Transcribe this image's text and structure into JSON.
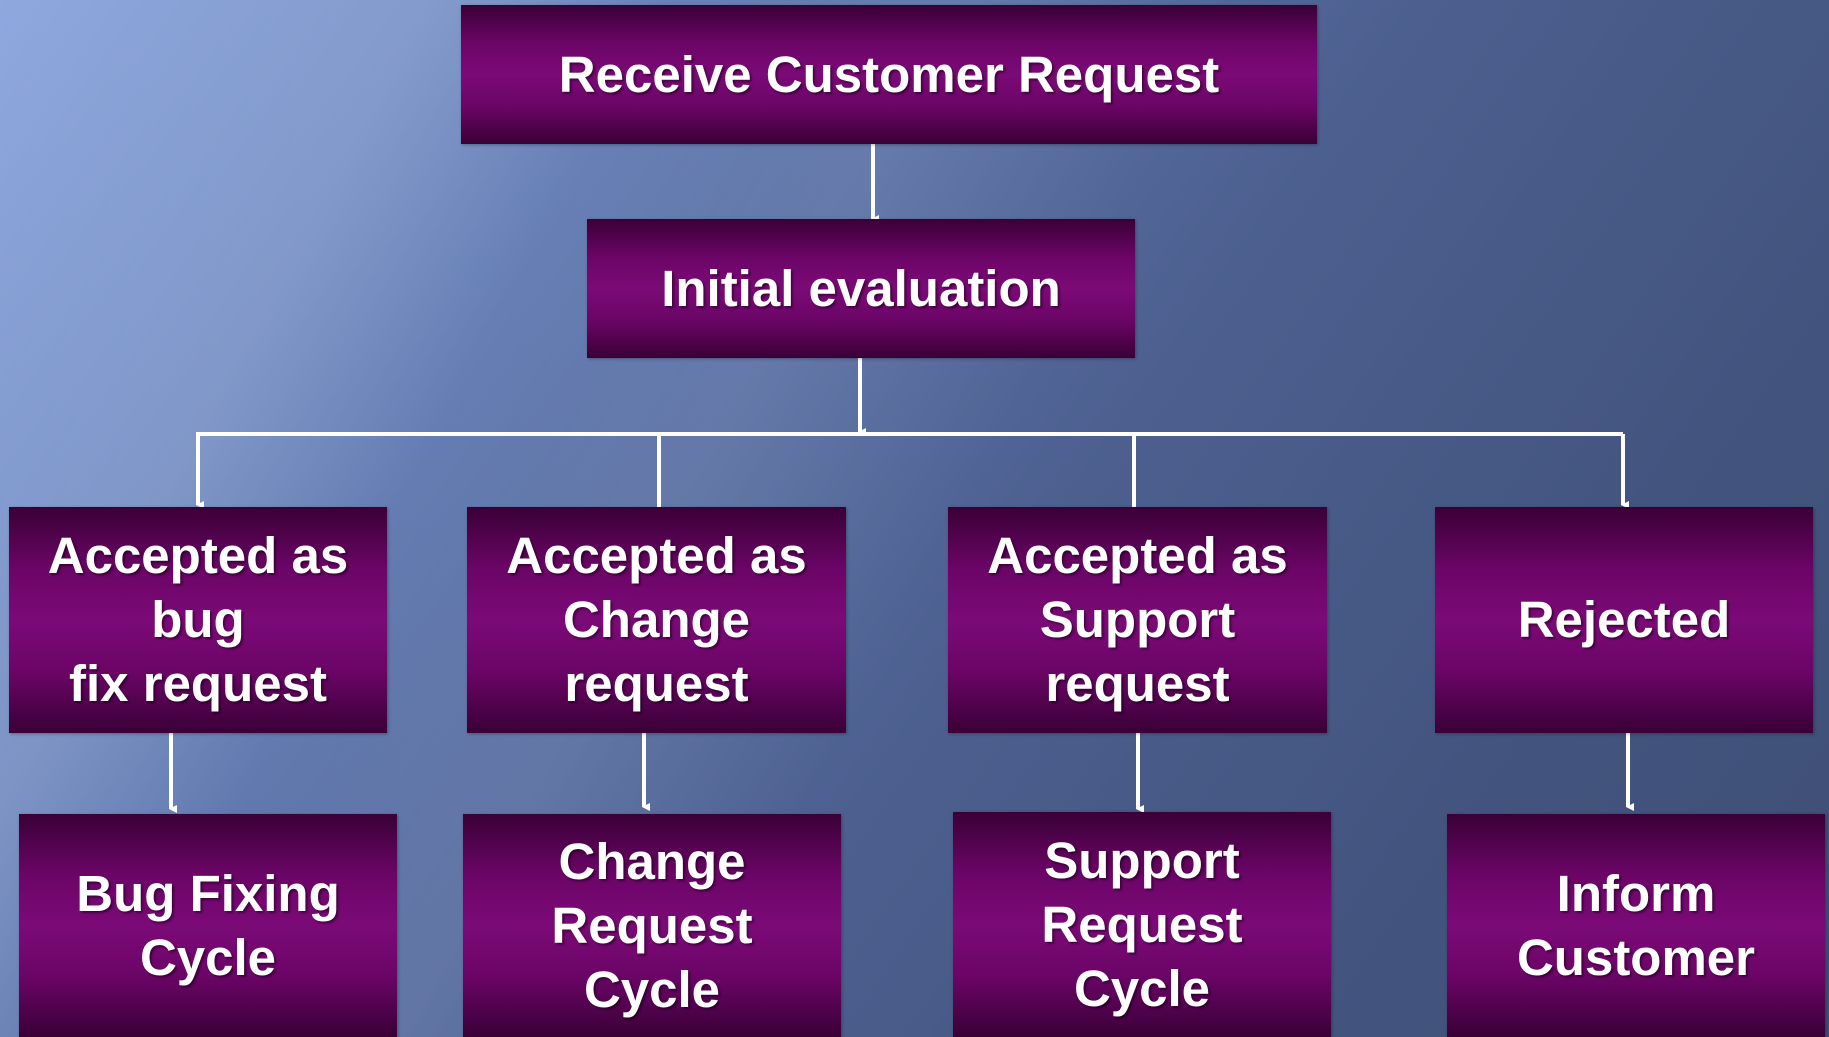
{
  "diagram": {
    "type": "flowchart",
    "top": {
      "request": "Receive Customer Request",
      "evaluation": "Initial evaluation"
    },
    "decisions": [
      {
        "id": "bug",
        "label": "Accepted as\nbug\nfix request"
      },
      {
        "id": "change",
        "label": "Accepted as\nChange\nrequest"
      },
      {
        "id": "support",
        "label": "Accepted as\nSupport\nrequest"
      },
      {
        "id": "rejected",
        "label": "Rejected"
      }
    ],
    "outcomes": [
      {
        "id": "bug",
        "label": "Bug Fixing\nCycle"
      },
      {
        "id": "change",
        "label": "Change\nRequest\nCycle"
      },
      {
        "id": "support",
        "label": "Support\nRequest\nCycle"
      },
      {
        "id": "rejected",
        "label": "Inform\nCustomer"
      }
    ],
    "edges": [
      {
        "from": "Receive Customer Request",
        "to": "Initial evaluation"
      },
      {
        "from": "Initial evaluation",
        "to": "Accepted as bug fix request"
      },
      {
        "from": "Initial evaluation",
        "to": "Accepted as Change request"
      },
      {
        "from": "Initial evaluation",
        "to": "Accepted as Support request"
      },
      {
        "from": "Initial evaluation",
        "to": "Rejected"
      },
      {
        "from": "Accepted as bug fix request",
        "to": "Bug Fixing Cycle"
      },
      {
        "from": "Accepted as Change request",
        "to": "Change Request Cycle"
      },
      {
        "from": "Accepted as Support request",
        "to": "Support Request Cycle"
      },
      {
        "from": "Rejected",
        "to": "Inform Customer"
      }
    ],
    "colors": {
      "box_fill": "#7b0a77",
      "box_edge": "#3a0036",
      "text": "#ffffff",
      "connector": "#ffffff"
    }
  }
}
